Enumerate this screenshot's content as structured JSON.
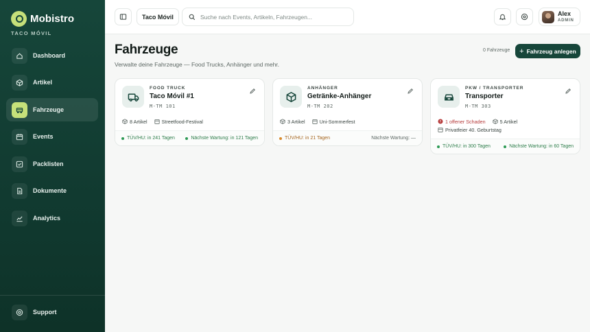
{
  "app": {
    "brand": "Mobistro",
    "tenant": "TACO MÓVIL"
  },
  "sidebar": {
    "items": [
      {
        "label": "Dashboard",
        "icon": "home-icon"
      },
      {
        "label": "Artikel",
        "icon": "package-icon"
      },
      {
        "label": "Fahrzeuge",
        "icon": "bus-icon",
        "active": true
      },
      {
        "label": "Events",
        "icon": "calendar-icon"
      },
      {
        "label": "Packlisten",
        "icon": "checklist-icon"
      },
      {
        "label": "Dokumente",
        "icon": "document-icon"
      },
      {
        "label": "Analytics",
        "icon": "chart-icon"
      }
    ],
    "support": "Support"
  },
  "topbar": {
    "workspace": "Taco Móvil",
    "search_placeholder": "Suche nach Events, Artikeln, Fahrzeugen...",
    "user_name": "Alex",
    "user_role": "ADMIN"
  },
  "page": {
    "title": "Fahrzeuge",
    "subtitle": "Verwalte deine Fahrzeuge — Food Trucks, Anhänger und mehr.",
    "count": "0 Fahrzeuge",
    "add_button": "Fahrzeug anlegen"
  },
  "vehicles": [
    {
      "type": "FOOD TRUCK",
      "name": "Taco Móvil #1",
      "plate": "M-TM 101",
      "articles": "8 Artikel",
      "event": "Streetfood-Festival",
      "tuv": "TÜV/HU: in 241 Tagen",
      "service": "Nächste Wartung: in 121 Tagen"
    },
    {
      "type": "ANHÄNGER",
      "name": "Getränke-Anhänger",
      "plate": "M-TM 202",
      "articles": "3 Artikel",
      "event": "Uni-Sommerfest",
      "tuv": "TÜV/HU: in 21 Tagen",
      "service": "Nächste Wartung: —"
    },
    {
      "type": "PKW / TRANSPORTER",
      "name": "Transporter",
      "plate": "M-TM 303",
      "damage": "1 offener Schaden",
      "articles": "5 Artikel",
      "event": "Privatfeier 40. Geburtstag",
      "tuv": "TÜV/HU: in 300 Tagen",
      "service": "Nächste Wartung: in 60 Tagen"
    }
  ],
  "colors": {
    "accent": "#16463a",
    "lime": "#c6e07a",
    "ok": "#2d9a55",
    "warn": "#d98a2b",
    "danger": "#b63b3b"
  }
}
